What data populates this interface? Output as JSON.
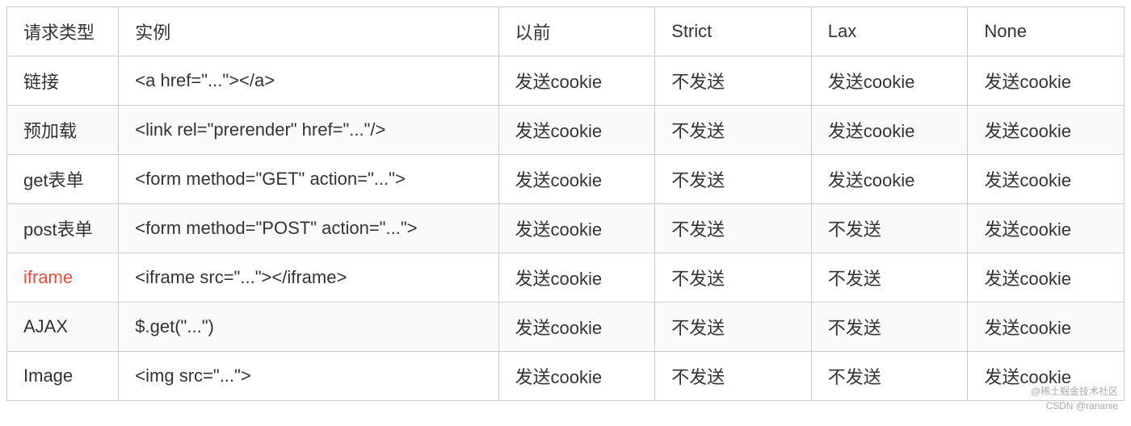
{
  "table": {
    "headers": [
      "请求类型",
      "实例",
      "以前",
      "Strict",
      "Lax",
      "None"
    ],
    "rows": [
      {
        "type": "链接",
        "type_red": false,
        "example": "<a href=\"...\"></a>",
        "before": "发送cookie",
        "strict": "不发送",
        "lax": "发送cookie",
        "none": "发送cookie"
      },
      {
        "type": "预加载",
        "type_red": false,
        "example": "<link rel=\"prerender\" href=\"...\"/>",
        "before": "发送cookie",
        "strict": "不发送",
        "lax": "发送cookie",
        "none": "发送cookie"
      },
      {
        "type": "get表单",
        "type_red": false,
        "example": "<form method=\"GET\" action=\"...\">",
        "before": "发送cookie",
        "strict": "不发送",
        "lax": "发送cookie",
        "none": "发送cookie"
      },
      {
        "type": "post表单",
        "type_red": false,
        "example": "<form method=\"POST\" action=\"...\">",
        "before": "发送cookie",
        "strict": "不发送",
        "lax": "不发送",
        "none": "发送cookie"
      },
      {
        "type": "iframe",
        "type_red": true,
        "example": "<iframe src=\"...\"></iframe>",
        "before": "发送cookie",
        "strict": "不发送",
        "lax": "不发送",
        "none": "发送cookie"
      },
      {
        "type": "AJAX",
        "type_red": false,
        "example": "$.get(\"...\")",
        "before": "发送cookie",
        "strict": "不发送",
        "lax": "不发送",
        "none": "发送cookie"
      },
      {
        "type": "Image",
        "type_red": false,
        "example": "<img src=\"...\">",
        "before": "发送cookie",
        "strict": "不发送",
        "lax": "不发送",
        "none": "发送cookie"
      }
    ],
    "watermark_line1": "@稀土掘金技术社区",
    "watermark_line2": "CSDN @rananie"
  }
}
